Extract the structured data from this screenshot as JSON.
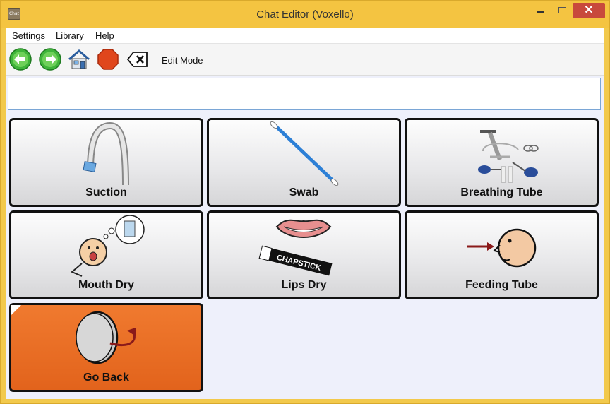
{
  "window": {
    "title": "Chat Editor (Voxello)",
    "icon_text": "Chat",
    "close_glyph": "✕"
  },
  "menu": {
    "settings": "Settings",
    "library": "Library",
    "help": "Help"
  },
  "toolbar": {
    "back_icon": "arrow-left-circle-icon",
    "forward_icon": "arrow-right-circle-icon",
    "home_icon": "house-icon",
    "stop_icon": "stop-octagon-icon",
    "clear_icon": "backspace-x-icon",
    "edit_mode_label": "Edit Mode"
  },
  "message": {
    "value": ""
  },
  "tiles": [
    {
      "label": "Suction",
      "icon": "suction-tube-icon"
    },
    {
      "label": "Swab",
      "icon": "swab-icon"
    },
    {
      "label": "Breathing Tube",
      "icon": "breathing-tube-icon"
    },
    {
      "label": "Mouth Dry",
      "icon": "thirsty-face-icon"
    },
    {
      "label": "Lips Dry",
      "icon": "lips-chapstick-icon"
    },
    {
      "label": "Feeding Tube",
      "icon": "feeding-tube-face-icon"
    },
    {
      "label": "Go Back",
      "icon": "go-back-plate-icon",
      "chapstick_text": "CHAPSTICK"
    }
  ],
  "colors": {
    "title_bar": "#f4c441",
    "tile_border": "#111111",
    "go_back_tile": "#e86a23",
    "close_button": "#c84a3c"
  }
}
